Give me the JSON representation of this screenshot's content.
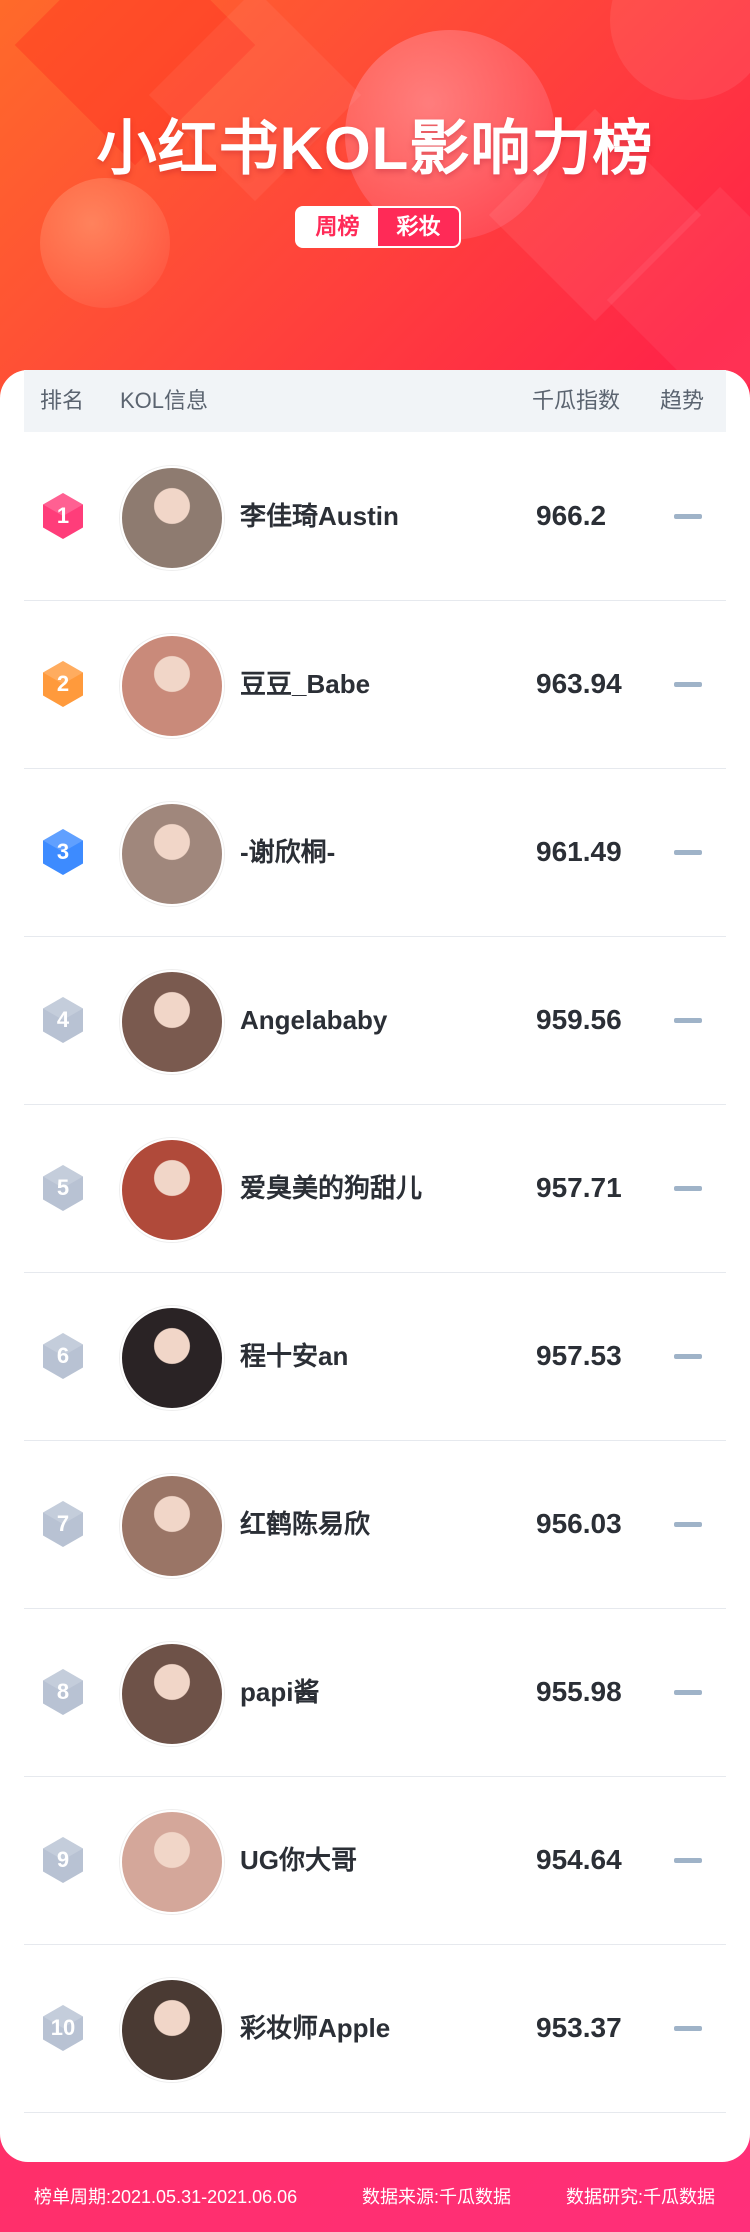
{
  "header": {
    "title": "小红书KOL影响力榜",
    "tabs": [
      {
        "label": "周榜",
        "active": true
      },
      {
        "label": "彩妆",
        "active": false
      }
    ]
  },
  "table": {
    "columns": {
      "rank": "排名",
      "kol": "KOL信息",
      "index": "千瓜指数",
      "trend": "趋势"
    },
    "rows": [
      {
        "rank": "1",
        "name": "李佳琦Austin",
        "score": "966.2",
        "trend": "flat",
        "badge_color": "#ff3d7a",
        "avatar": "#8e7b70"
      },
      {
        "rank": "2",
        "name": "豆豆_Babe",
        "score": "963.94",
        "trend": "flat",
        "badge_color": "#ff9a3c",
        "avatar": "#c98a7a"
      },
      {
        "rank": "3",
        "name": "-谢欣桐-",
        "score": "961.49",
        "trend": "flat",
        "badge_color": "#3d8bff",
        "avatar": "#a0877c"
      },
      {
        "rank": "4",
        "name": "Angelababy",
        "score": "959.56",
        "trend": "flat",
        "badge_color": "#b8c2d3",
        "avatar": "#7a5a4f"
      },
      {
        "rank": "5",
        "name": "爱臭美的狗甜儿",
        "score": "957.71",
        "trend": "flat",
        "badge_color": "#b8c2d3",
        "avatar": "#b04a3a"
      },
      {
        "rank": "6",
        "name": "程十安an",
        "score": "957.53",
        "trend": "flat",
        "badge_color": "#b8c2d3",
        "avatar": "#2a2325"
      },
      {
        "rank": "7",
        "name": "红鹤陈易欣",
        "score": "956.03",
        "trend": "flat",
        "badge_color": "#b8c2d3",
        "avatar": "#9a7566"
      },
      {
        "rank": "8",
        "name": "papi酱",
        "score": "955.98",
        "trend": "flat",
        "badge_color": "#b8c2d3",
        "avatar": "#6e5248"
      },
      {
        "rank": "9",
        "name": "UG你大哥",
        "score": "954.64",
        "trend": "flat",
        "badge_color": "#b8c2d3",
        "avatar": "#d4a79a"
      },
      {
        "rank": "10",
        "name": "彩妆师Apple",
        "score": "953.37",
        "trend": "flat",
        "badge_color": "#b8c2d3",
        "avatar": "#4a3a33"
      }
    ]
  },
  "footer": {
    "period": "榜单周期:2021.05.31-2021.06.06",
    "source": "数据来源:千瓜数据",
    "research": "数据研究:千瓜数据"
  },
  "colors": {
    "brand": "#ff2a57",
    "trend_flat": "#9fb3c8"
  }
}
